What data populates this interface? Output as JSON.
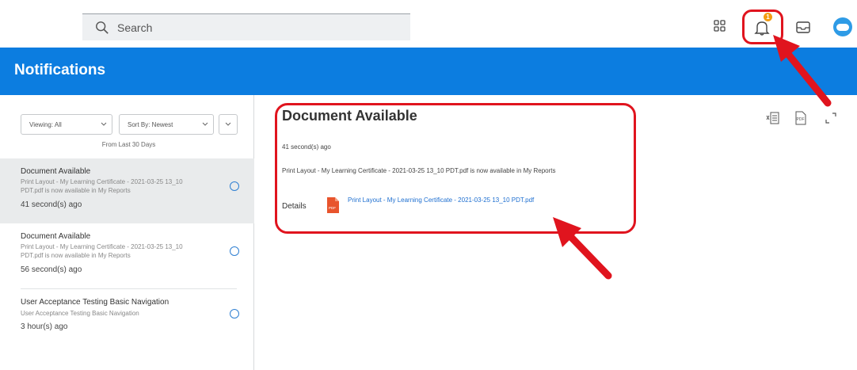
{
  "topbar": {
    "search_placeholder": "Search",
    "icons": [
      "search-icon",
      "apps-grid-icon",
      "bell-icon",
      "inbox-icon",
      "avatar"
    ],
    "bell_badge_count": "1"
  },
  "header": {
    "title": "Notifications"
  },
  "sidebar": {
    "viewing_label": "Viewing: All",
    "sort_label": "Sort By: Newest",
    "from_days": "From Last 30 Days",
    "notifications": [
      {
        "title": "Document Available",
        "body_line1": "Print Layout - My Learning Certificate - 2021-03-25 13_10",
        "body_line2": "PDT.pdf is now available in My Reports",
        "time": "41 second(s) ago"
      },
      {
        "title": "Document Available",
        "body_line1": "Print Layout - My Learning Certificate - 2021-03-25 13_10",
        "body_line2": "PDT.pdf is now available in My Reports",
        "time": "56 second(s) ago"
      },
      {
        "title": "User Acceptance Testing Basic Navigation",
        "body_line1": "User Acceptance Testing Basic Navigation",
        "body_line2": "",
        "time": "3 hour(s) ago"
      }
    ]
  },
  "main": {
    "title": "Document Available",
    "time": "41 second(s) ago",
    "body": "Print Layout - My Learning Certificate - 2021-03-25 13_10 PDT.pdf is now available in My Reports",
    "details_label": "Details",
    "attachment_link": "Print Layout - My Learning Certificate - 2021-03-25 13_10 PDT.pdf",
    "pdf_badge": "PDF",
    "actions": [
      "excel-export-icon",
      "pdf-export-icon",
      "expand-icon"
    ]
  },
  "colors": {
    "brand_blue": "#0c7de0",
    "highlight_red": "#e0141e",
    "badge_orange": "#f39c12",
    "link_blue": "#1e6fd0"
  }
}
